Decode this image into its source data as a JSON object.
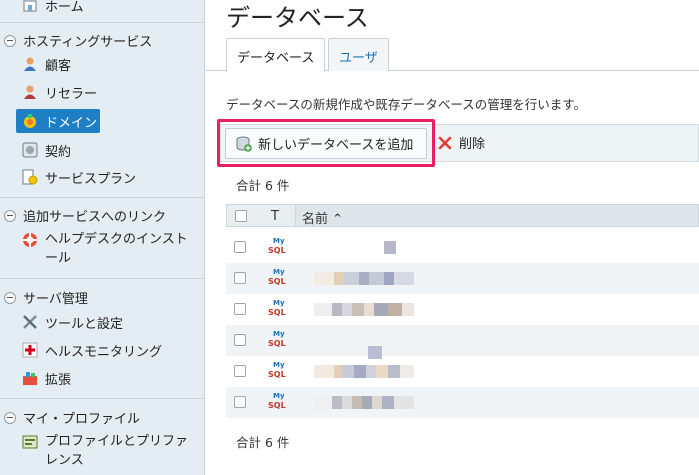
{
  "sidebar": {
    "home": "ホーム",
    "sections": [
      {
        "label": "ホスティングサービス"
      },
      {
        "label": "追加サービスへのリンク"
      },
      {
        "label": "サーバ管理"
      },
      {
        "label": "マイ・プロファイル"
      }
    ],
    "hosting_items": [
      {
        "label": "顧客",
        "icon": "customer-icon"
      },
      {
        "label": "リセラー",
        "icon": "reseller-icon"
      },
      {
        "label": "ドメイン",
        "icon": "domain-icon"
      },
      {
        "label": "契約",
        "icon": "subscription-icon"
      },
      {
        "label": "サービスプラン",
        "icon": "service-plan-icon"
      }
    ],
    "link_items": [
      {
        "label": "ヘルプデスクのインストール",
        "icon": "lifebuoy-icon"
      }
    ],
    "server_items": [
      {
        "label": "ツールと設定",
        "icon": "tools-icon"
      },
      {
        "label": "ヘルスモニタリング",
        "icon": "health-icon"
      },
      {
        "label": "拡張",
        "icon": "extension-icon"
      }
    ],
    "profile_items": [
      {
        "label": "プロファイルとプリファレンス",
        "icon": "profile-icon"
      }
    ]
  },
  "main": {
    "title": "データベース",
    "tabs": [
      {
        "label": "データベース",
        "active": true
      },
      {
        "label": "ユーザ",
        "active": false
      }
    ],
    "description": "データベースの新規作成や既存データベースの管理を行います。",
    "toolbar": {
      "add_label": "新しいデータベースを追加",
      "delete_label": "削除"
    },
    "total_top": "合計 6 件",
    "total_bottom": "合計 6 件",
    "table": {
      "col_type": "T",
      "col_name": "名前 ⌃",
      "rows": [
        {
          "type": "MySQL"
        },
        {
          "type": "MySQL"
        },
        {
          "type": "MySQL"
        },
        {
          "type": "MySQL"
        },
        {
          "type": "MySQL"
        },
        {
          "type": "MySQL"
        }
      ]
    }
  },
  "colors": {
    "highlight": "#e91e63",
    "active_nav": "#1f7fc4",
    "link": "#1e6fb0"
  }
}
